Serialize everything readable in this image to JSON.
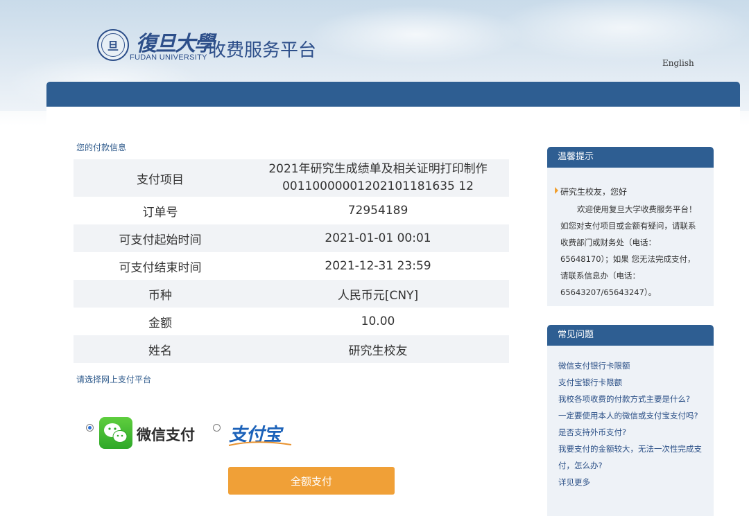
{
  "header": {
    "seal_text": "旦",
    "university_cn": "復旦大學",
    "university_en": "FUDAN UNIVERSITY",
    "platform_title": "收费服务平台",
    "language_link": "English"
  },
  "payment_info": {
    "section_title": "您的付款信息",
    "rows": [
      {
        "label": "支付项目",
        "value_line1": "2021年研究生成绩单及相关证明打印制作",
        "value_line2": "00110000001202101181635 12"
      },
      {
        "label": "订单号",
        "value": "72954189"
      },
      {
        "label": "可支付起始时间",
        "value": "2021-01-01 00:01"
      },
      {
        "label": "可支付结束时间",
        "value": "2021-12-31 23:59"
      },
      {
        "label": "币种",
        "value": "人民币元[CNY]"
      },
      {
        "label": "金额",
        "value": "10.00"
      },
      {
        "label": "姓名",
        "value": "研究生校友"
      }
    ]
  },
  "platform_select": {
    "section_title": "请选择网上支付平台",
    "options": [
      {
        "name": "微信支付",
        "selected": true
      },
      {
        "name": "支付宝",
        "selected": false
      }
    ],
    "pay_button": "全额支付"
  },
  "tips": {
    "title": "温馨提示",
    "greeting": "研究生校友，您好",
    "body": "欢迎使用复旦大学收费服务平台！如您对支付项目或金额有疑问，请联系收费部门或财务处（电话：65648170）；如果 您无法完成支付，请联系信息办（电话：65643207/65643247）。"
  },
  "faq": {
    "title": "常见问题",
    "items": [
      "微信支付银行卡限额",
      "支付宝银行卡限额",
      "我校各项收费的付款方式主要是什么?",
      "一定要使用本人的微信或支付宝支付吗?",
      "是否支持外币支付?",
      "我要支付的金额较大，无法一次性完成支付，怎么办?",
      "详见更多"
    ]
  },
  "colors": {
    "primary_blue": "#2e5e92",
    "accent_orange": "#f0a037",
    "wechat_green": "#2ea829",
    "alipay_blue": "#1c62b9"
  }
}
